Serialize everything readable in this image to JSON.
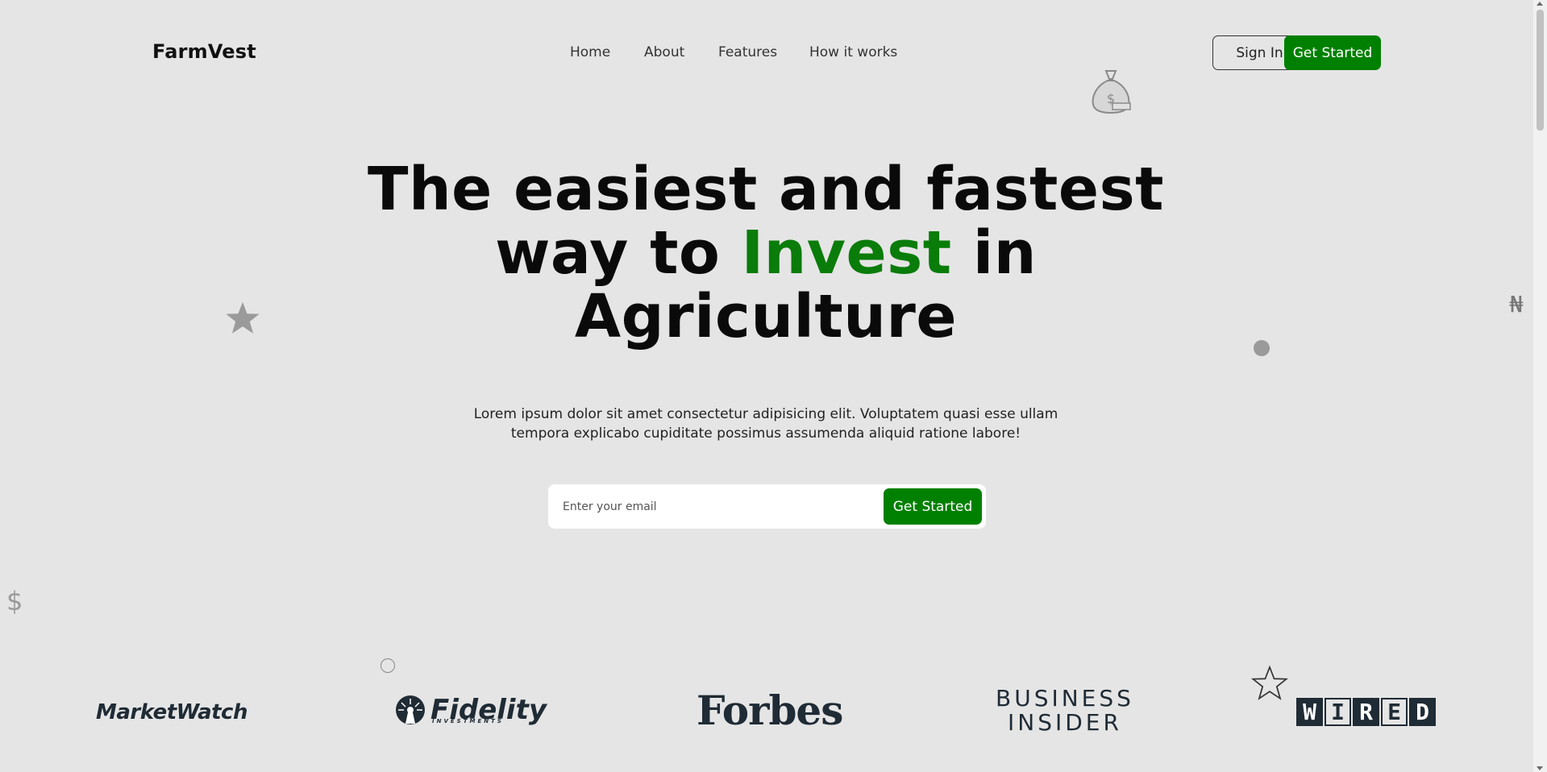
{
  "brand": "FarmVest",
  "nav": {
    "items": [
      "Home",
      "About",
      "Features",
      "How it works"
    ]
  },
  "header_actions": {
    "sign_in": "Sign In",
    "get_started": "Get Started"
  },
  "hero": {
    "title_part1": "The easiest and fastest way to ",
    "title_accent": "Invest",
    "title_part2": " in Agriculture",
    "subtitle": "Lorem ipsum dolor sit amet consectetur adipisicing elit. Voluptatem quasi esse ullam tempora explicabo cupiditate possimus assumenda aliquid ratione labore!",
    "email_placeholder": "Enter your email",
    "cta": "Get Started"
  },
  "decorations": {
    "currency_naira": "₦",
    "currency_dollar": "$"
  },
  "press_logos": {
    "marketwatch": "MarketWatch",
    "fidelity": "Fidelity",
    "fidelity_sub": "INVESTMENTS",
    "forbes": "Forbes",
    "business_insider_line1": "BUSINESS",
    "business_insider_line2": "INSIDER",
    "wired_letters": [
      "W",
      "I",
      "R",
      "E",
      "D"
    ]
  },
  "colors": {
    "accent": "#008000",
    "background": "#e5e5e5",
    "logo": "#1f2b35"
  }
}
